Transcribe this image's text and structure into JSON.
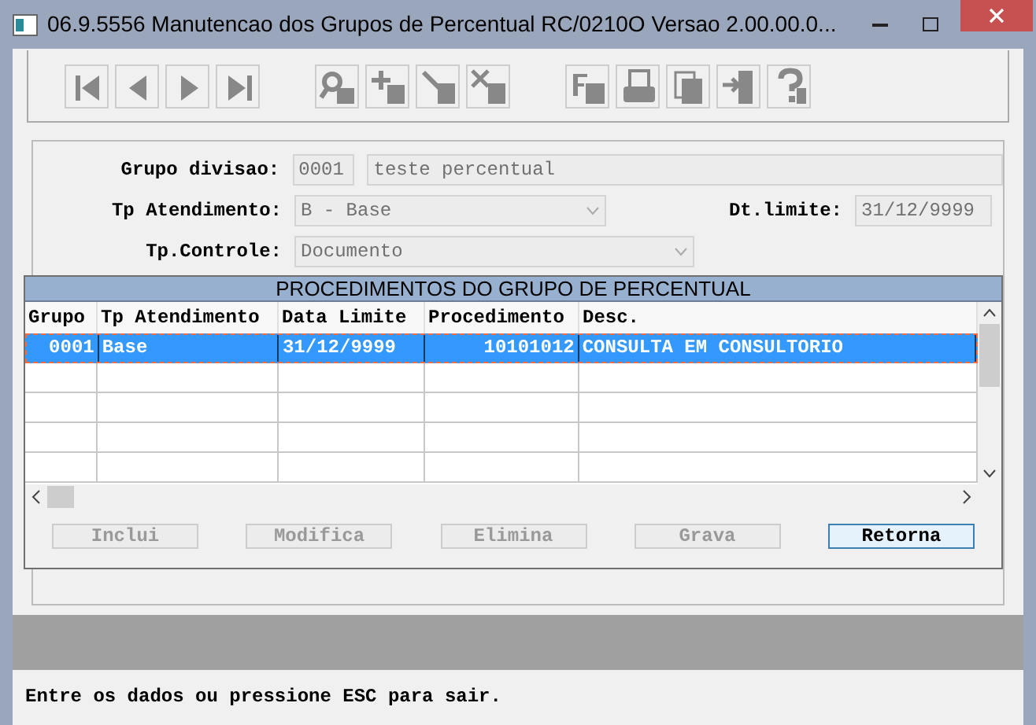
{
  "window": {
    "title": "06.9.5556 Manutencao dos  Grupos de Percentual RC/0210O Versao 2.00.00.0..."
  },
  "form": {
    "fields": [
      {
        "label": "Grupo divisao:",
        "code": "0001",
        "value": "teste percentual"
      },
      {
        "label": "Tp Atendimento:",
        "value": "B - Base",
        "kind": "select"
      },
      {
        "label": "Dt.limite:",
        "value": "31/12/9999"
      },
      {
        "label": "Tp.Controle:",
        "value": "Documento",
        "kind": "select"
      }
    ]
  },
  "dialog": {
    "title": "PROCEDIMENTOS DO GRUPO DE PERCENTUAL",
    "columns": [
      "Grupo",
      "Tp Atendimento",
      "Data Limite",
      "Procedimento",
      "Desc."
    ],
    "rows": [
      {
        "cells": [
          "0001",
          "Base",
          "31/12/9999",
          "10101012",
          "CONSULTA EM CONSULTORIO"
        ],
        "selected": true
      }
    ],
    "buttons": [
      {
        "label": "Inclui",
        "disabled": true
      },
      {
        "label": "Modifica",
        "disabled": true
      },
      {
        "label": "Elimina",
        "disabled": true
      },
      {
        "label": "Grava",
        "disabled": true
      },
      {
        "label": "Retorna",
        "disabled": false
      }
    ]
  },
  "status_bar": {
    "message": "Entre os dados ou pressione ESC para sair."
  }
}
